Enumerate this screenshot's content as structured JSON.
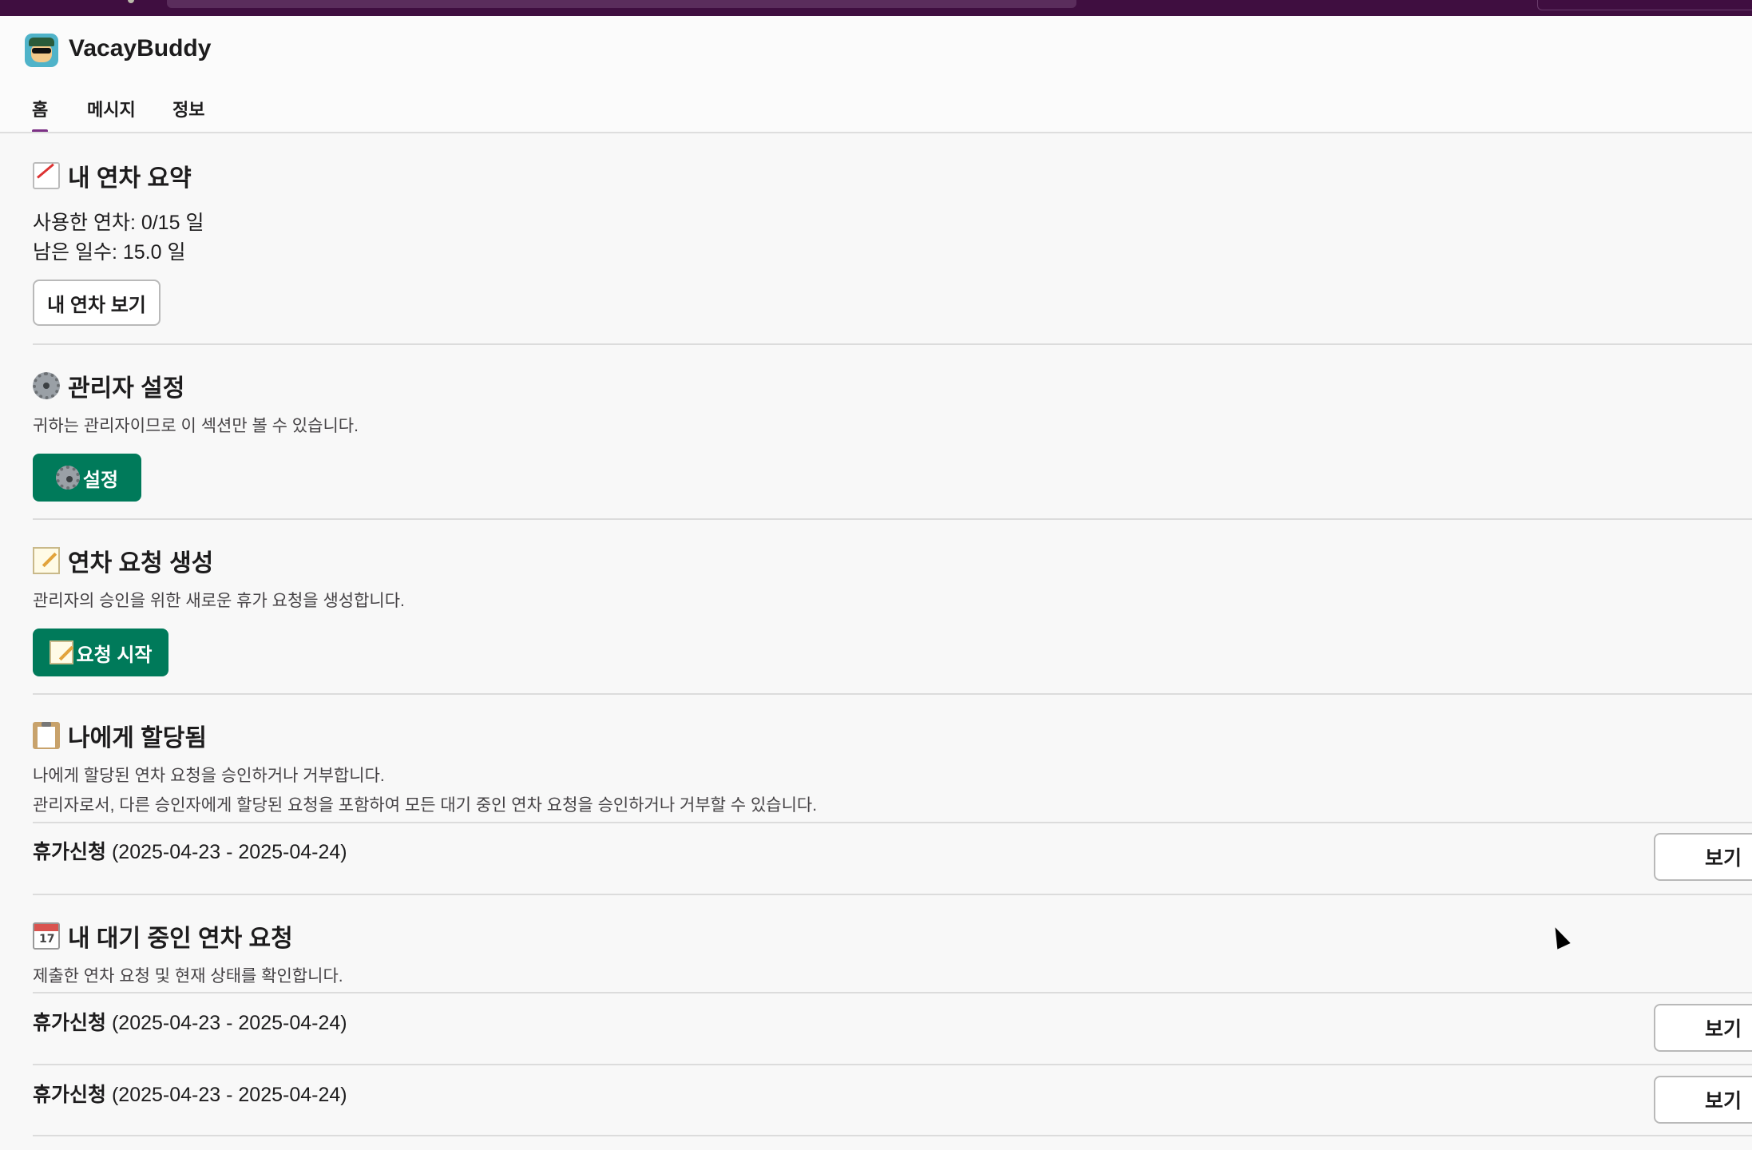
{
  "app": {
    "title": "VacayBuddy"
  },
  "tabs": [
    {
      "label": "홈",
      "active": true
    },
    {
      "label": "메시지",
      "active": false
    },
    {
      "label": "정보",
      "active": false
    }
  ],
  "summary": {
    "heading": "내 연차 요약",
    "used": "사용한 연차: 0/15 일",
    "remaining": "남은 일수: 15.0 일",
    "button": "내 연차 보기"
  },
  "admin": {
    "heading": "관리자 설정",
    "description": "귀하는 관리자이므로 이 섹션만 볼 수 있습니다.",
    "button": "설정"
  },
  "create": {
    "heading": "연차 요청 생성",
    "description": "관리자의 승인을 위한 새로운 휴가 요청을 생성합니다.",
    "button": "요청 시작"
  },
  "assigned": {
    "heading": "나에게 할당됨",
    "description1": "나에게 할당된 연차 요청을 승인하거나 거부합니다.",
    "description2": "관리자로서, 다른 승인자에게 할당된 요청을 포함하여 모든 대기 중인 연차 요청을 승인하거나 거부할 수 있습니다.",
    "items": [
      {
        "title": "휴가신청",
        "dates": " (2025-04-23 - 2025-04-24)",
        "button": "보기"
      }
    ]
  },
  "pending": {
    "heading": "내 대기 중인 연차 요청",
    "description": "제출한 연차 요청 및 현재 상태를 확인합니다.",
    "items": [
      {
        "title": "휴가신청",
        "dates": " (2025-04-23 - 2025-04-24)",
        "button": "보기"
      },
      {
        "title": "휴가신청",
        "dates": " (2025-04-23 - 2025-04-24)",
        "button": "보기"
      }
    ]
  },
  "colors": {
    "primary_button": "#007a5a",
    "tab_indicator": "#7c3085",
    "topbar": "#3f0e40"
  },
  "icons": {
    "summary": "chart-increasing-icon",
    "admin": "gear-icon",
    "create": "memo-icon",
    "assigned": "clipboard-icon",
    "pending": "calendar-icon"
  }
}
